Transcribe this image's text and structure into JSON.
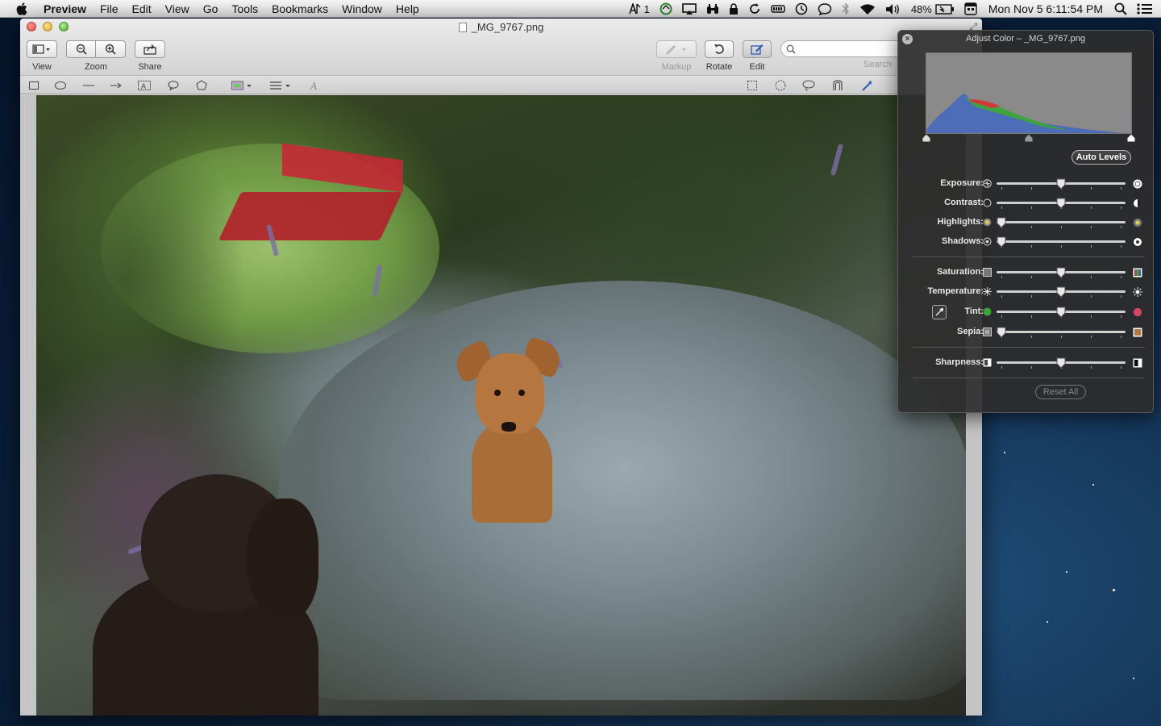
{
  "menubar": {
    "app_name": "Preview",
    "items": [
      "File",
      "Edit",
      "View",
      "Go",
      "Tools",
      "Bookmarks",
      "Window",
      "Help"
    ],
    "status": {
      "input_indicator": "1",
      "battery": "48%",
      "clock": "Mon Nov 5  6:11:54 PM"
    }
  },
  "window": {
    "title": "_MG_9767.png",
    "toolbar": {
      "view_label": "View",
      "zoom_label": "Zoom",
      "share_label": "Share",
      "markup_label": "Markup",
      "rotate_label": "Rotate",
      "edit_label": "Edit",
      "search_label": "Search",
      "search_placeholder": ""
    }
  },
  "adjust_color": {
    "title": "Adjust Color – _MG_9767.png",
    "auto_levels": "Auto Levels",
    "reset_all": "Reset All",
    "sliders": [
      {
        "label": "Exposure:",
        "value": 0.5
      },
      {
        "label": "Contrast:",
        "value": 0.5
      },
      {
        "label": "Highlights:",
        "value": 0.0
      },
      {
        "label": "Shadows:",
        "value": 0.0
      },
      {
        "label": "Saturation:",
        "value": 0.5
      },
      {
        "label": "Temperature:",
        "value": 0.5
      },
      {
        "label": "Tint:",
        "value": 0.5
      },
      {
        "label": "Sepia:",
        "value": 0.0
      },
      {
        "label": "Sharpness:",
        "value": 0.5
      }
    ],
    "levels": {
      "black": 0.0,
      "mid": 0.5,
      "white": 1.0
    },
    "colors": {
      "hud_bg": "#2c2c2c",
      "histo_blue": "#4e6db8",
      "histo_red": "#d23a3a",
      "histo_green": "#3aa63a"
    }
  }
}
